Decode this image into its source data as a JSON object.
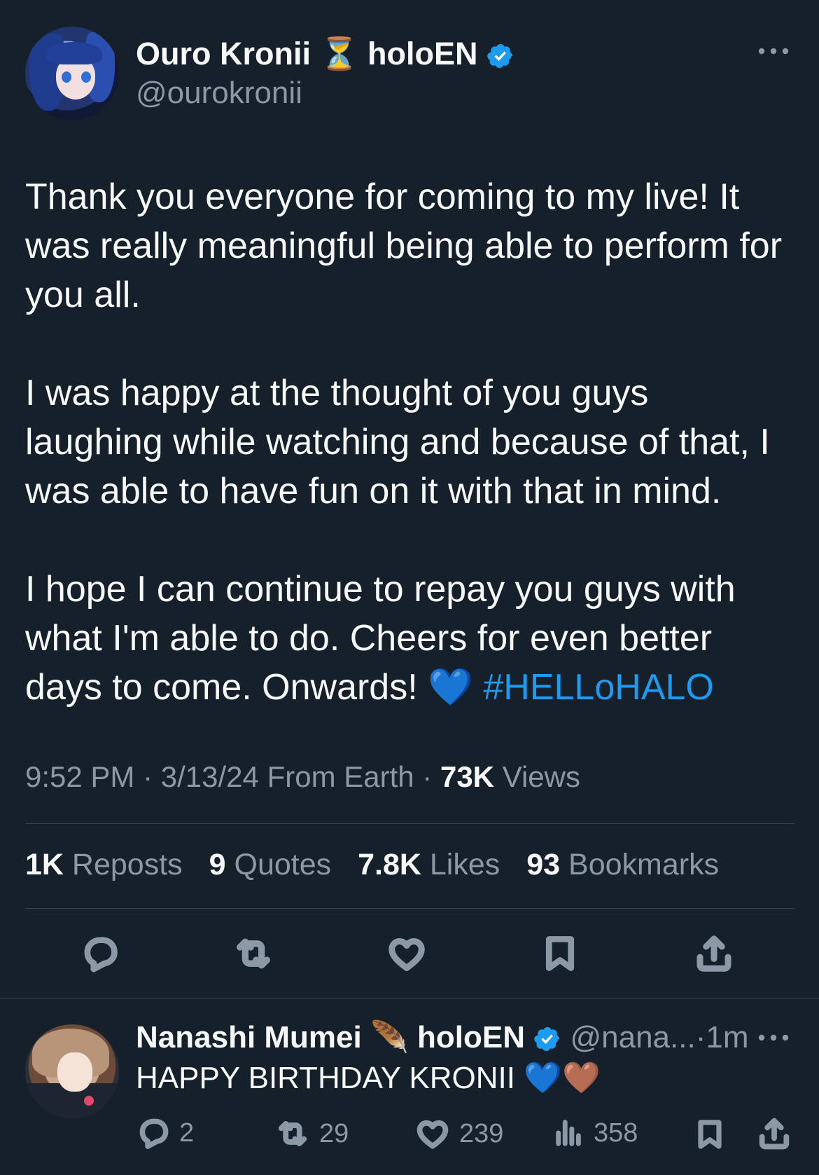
{
  "tweet": {
    "author_name": "Ouro Kronii",
    "author_emoji": "⏳",
    "author_tag": "holoEN",
    "handle": "@ourokronii",
    "more_icon": "more-horizontal-icon",
    "paragraphs": [
      "Thank you everyone for coming to my live! It was really meaningful being able to perform for you all.",
      "I was happy at the thought of you guys laughing while watching and because of that, I was able to have fun on it with that in mind.",
      "I hope I can continue to repay you guys with what I'm able to do. Cheers for even better days to come. Onwards!"
    ],
    "closing_emoji": "💙",
    "hashtag": "#HELLoHALO",
    "time": "9:52 PM",
    "date": "3/13/24",
    "source": "From Earth",
    "views_count": "73K",
    "views_label": "Views",
    "separator": "·",
    "stats": {
      "reposts_count": "1K",
      "reposts_label": "Reposts",
      "quotes_count": "9",
      "quotes_label": "Quotes",
      "likes_count": "7.8K",
      "likes_label": "Likes",
      "bookmarks_count": "93",
      "bookmarks_label": "Bookmarks"
    },
    "actions": [
      "reply-icon",
      "repost-icon",
      "like-icon",
      "bookmark-icon",
      "share-icon"
    ]
  },
  "reply": {
    "author_name": "Nanashi Mumei",
    "author_emoji": "🪶",
    "author_tag": "holoEN",
    "handle": "@nana...",
    "time": "1m",
    "separator": "·",
    "text": "HAPPY BIRTHDAY KRONII",
    "emojis": "💙🤎",
    "replies": "2",
    "reposts": "29",
    "likes": "239",
    "views": "358"
  },
  "colors": {
    "background": "#15202b",
    "text": "#f7f9f9",
    "secondary": "#8b98a5",
    "accent": "#1d9bf0",
    "divider": "#38444d"
  }
}
